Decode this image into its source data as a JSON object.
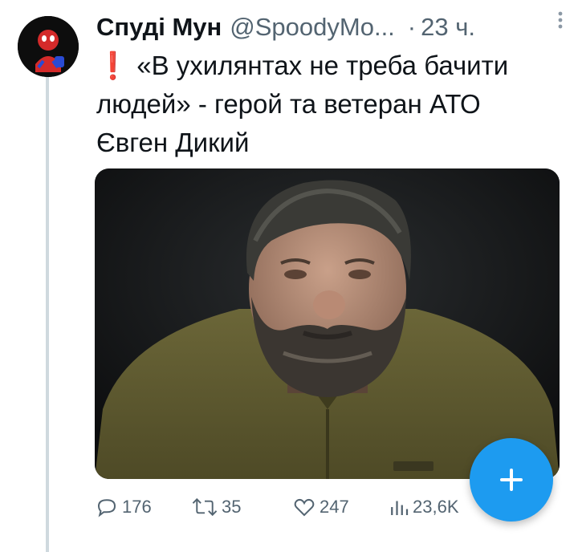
{
  "tweet": {
    "author_name": "Спуді Мун",
    "author_handle": "@SpoodyMo...",
    "separator": "·",
    "time": "23 ч.",
    "text_lines": [
      "«В ухилянтах не треба бачити",
      "людей» - герой та ветеран АТО",
      "Євген Дикий"
    ],
    "emoji_prefix": "❗"
  },
  "actions": {
    "replies": "176",
    "retweets": "35",
    "likes": "247",
    "views": "23,6K"
  },
  "icons": {
    "reply": "reply-icon",
    "retweet": "retweet-icon",
    "like": "heart-icon",
    "views": "views-icon",
    "more": "more-vertical-icon",
    "compose": "plus-icon"
  },
  "colors": {
    "accent": "#1d9bf0",
    "text": "#0f1419",
    "secondary": "#536471",
    "thread_line": "#cfd9de",
    "exclamation": "#e0245e"
  }
}
